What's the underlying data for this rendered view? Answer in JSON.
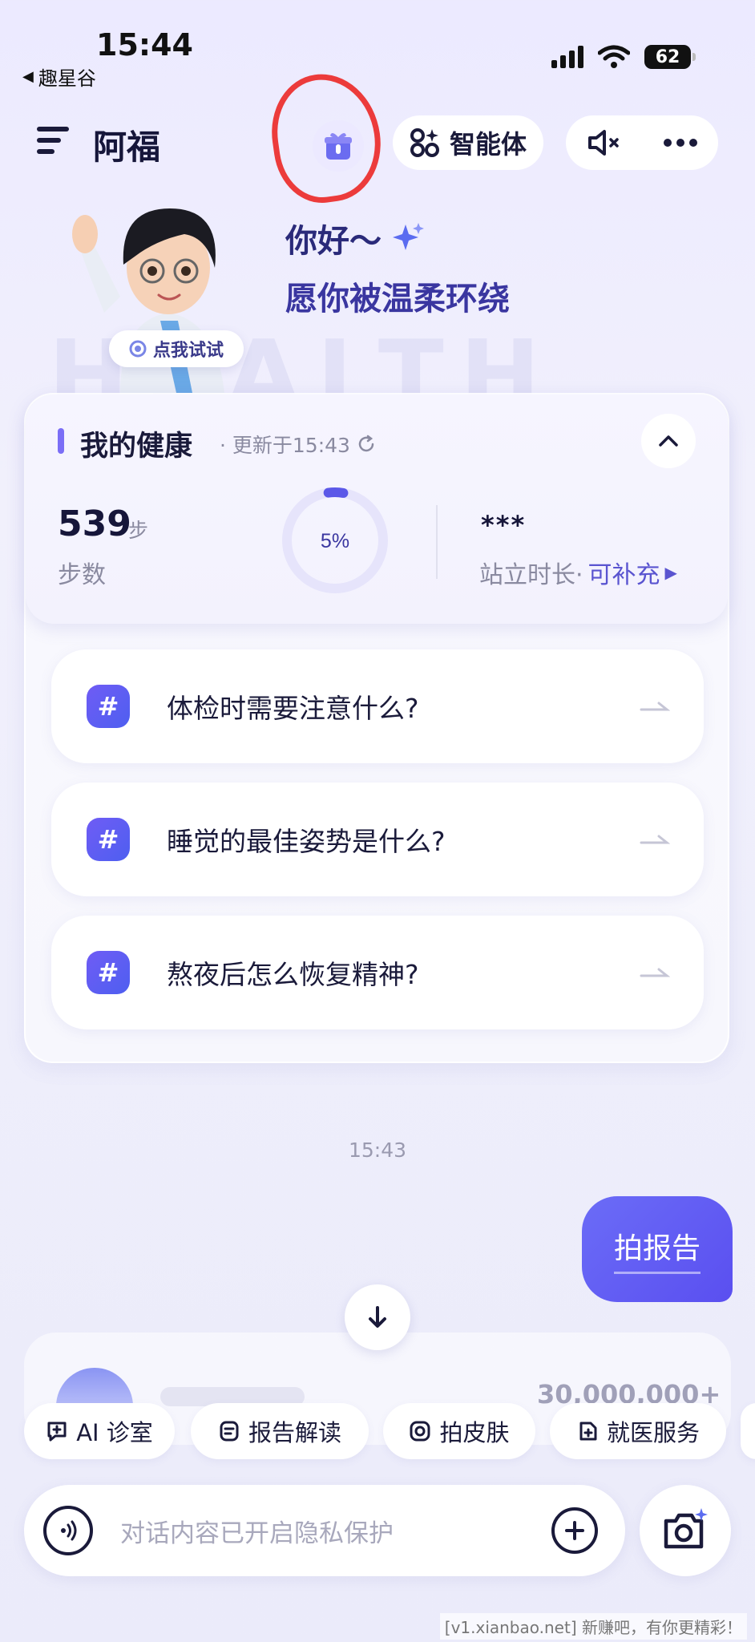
{
  "status_bar": {
    "time": "15:44",
    "back_app": "趣星谷",
    "battery": "62"
  },
  "header": {
    "title": "阿福",
    "agent_label": "智能体"
  },
  "avatar": {
    "try_label": "点我试试"
  },
  "greeting": {
    "line1": "你好～",
    "line2": "愿你被温柔环绕"
  },
  "health": {
    "title": "我的健康",
    "updated": "· 更新于15:43",
    "steps_value": "539",
    "steps_unit": "步",
    "steps_label": "步数",
    "ring_label": "5%",
    "ring_progress": 0.05,
    "stand_value": "***",
    "stand_label": "站立时长·",
    "stand_action": "可补充"
  },
  "questions": [
    {
      "text": "体检时需要注意什么?"
    },
    {
      "text": "睡觉的最佳姿势是什么?"
    },
    {
      "text": "熬夜后怎么恢复精神?"
    }
  ],
  "chat": {
    "timestamp": "15:43",
    "user_message": "拍报告",
    "faded_number": "30,000,000+"
  },
  "chips": [
    {
      "label": "AI 诊室",
      "icon": "ai-clinic-icon"
    },
    {
      "label": "报告解读",
      "icon": "report-icon"
    },
    {
      "label": "拍皮肤",
      "icon": "camera-skin-icon"
    },
    {
      "label": "就医服务",
      "icon": "medical-service-icon"
    }
  ],
  "input": {
    "placeholder": "对话内容已开启隐私保护"
  },
  "watermark": "[v1.xianbao.net] 新赚吧，有你更精彩！",
  "colors": {
    "accent": "#5a54d0",
    "annotation": "#ec3b3b"
  }
}
